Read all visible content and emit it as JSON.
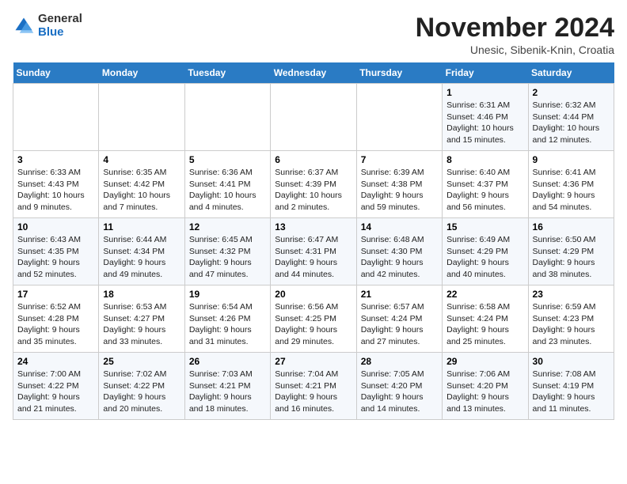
{
  "logo": {
    "general": "General",
    "blue": "Blue"
  },
  "title": "November 2024",
  "subtitle": "Unesic, Sibenik-Knin, Croatia",
  "days_of_week": [
    "Sunday",
    "Monday",
    "Tuesday",
    "Wednesday",
    "Thursday",
    "Friday",
    "Saturday"
  ],
  "weeks": [
    [
      {
        "day": "",
        "info": ""
      },
      {
        "day": "",
        "info": ""
      },
      {
        "day": "",
        "info": ""
      },
      {
        "day": "",
        "info": ""
      },
      {
        "day": "",
        "info": ""
      },
      {
        "day": "1",
        "info": "Sunrise: 6:31 AM\nSunset: 4:46 PM\nDaylight: 10 hours and 15 minutes."
      },
      {
        "day": "2",
        "info": "Sunrise: 6:32 AM\nSunset: 4:44 PM\nDaylight: 10 hours and 12 minutes."
      }
    ],
    [
      {
        "day": "3",
        "info": "Sunrise: 6:33 AM\nSunset: 4:43 PM\nDaylight: 10 hours and 9 minutes."
      },
      {
        "day": "4",
        "info": "Sunrise: 6:35 AM\nSunset: 4:42 PM\nDaylight: 10 hours and 7 minutes."
      },
      {
        "day": "5",
        "info": "Sunrise: 6:36 AM\nSunset: 4:41 PM\nDaylight: 10 hours and 4 minutes."
      },
      {
        "day": "6",
        "info": "Sunrise: 6:37 AM\nSunset: 4:39 PM\nDaylight: 10 hours and 2 minutes."
      },
      {
        "day": "7",
        "info": "Sunrise: 6:39 AM\nSunset: 4:38 PM\nDaylight: 9 hours and 59 minutes."
      },
      {
        "day": "8",
        "info": "Sunrise: 6:40 AM\nSunset: 4:37 PM\nDaylight: 9 hours and 56 minutes."
      },
      {
        "day": "9",
        "info": "Sunrise: 6:41 AM\nSunset: 4:36 PM\nDaylight: 9 hours and 54 minutes."
      }
    ],
    [
      {
        "day": "10",
        "info": "Sunrise: 6:43 AM\nSunset: 4:35 PM\nDaylight: 9 hours and 52 minutes."
      },
      {
        "day": "11",
        "info": "Sunrise: 6:44 AM\nSunset: 4:34 PM\nDaylight: 9 hours and 49 minutes."
      },
      {
        "day": "12",
        "info": "Sunrise: 6:45 AM\nSunset: 4:32 PM\nDaylight: 9 hours and 47 minutes."
      },
      {
        "day": "13",
        "info": "Sunrise: 6:47 AM\nSunset: 4:31 PM\nDaylight: 9 hours and 44 minutes."
      },
      {
        "day": "14",
        "info": "Sunrise: 6:48 AM\nSunset: 4:30 PM\nDaylight: 9 hours and 42 minutes."
      },
      {
        "day": "15",
        "info": "Sunrise: 6:49 AM\nSunset: 4:29 PM\nDaylight: 9 hours and 40 minutes."
      },
      {
        "day": "16",
        "info": "Sunrise: 6:50 AM\nSunset: 4:29 PM\nDaylight: 9 hours and 38 minutes."
      }
    ],
    [
      {
        "day": "17",
        "info": "Sunrise: 6:52 AM\nSunset: 4:28 PM\nDaylight: 9 hours and 35 minutes."
      },
      {
        "day": "18",
        "info": "Sunrise: 6:53 AM\nSunset: 4:27 PM\nDaylight: 9 hours and 33 minutes."
      },
      {
        "day": "19",
        "info": "Sunrise: 6:54 AM\nSunset: 4:26 PM\nDaylight: 9 hours and 31 minutes."
      },
      {
        "day": "20",
        "info": "Sunrise: 6:56 AM\nSunset: 4:25 PM\nDaylight: 9 hours and 29 minutes."
      },
      {
        "day": "21",
        "info": "Sunrise: 6:57 AM\nSunset: 4:24 PM\nDaylight: 9 hours and 27 minutes."
      },
      {
        "day": "22",
        "info": "Sunrise: 6:58 AM\nSunset: 4:24 PM\nDaylight: 9 hours and 25 minutes."
      },
      {
        "day": "23",
        "info": "Sunrise: 6:59 AM\nSunset: 4:23 PM\nDaylight: 9 hours and 23 minutes."
      }
    ],
    [
      {
        "day": "24",
        "info": "Sunrise: 7:00 AM\nSunset: 4:22 PM\nDaylight: 9 hours and 21 minutes."
      },
      {
        "day": "25",
        "info": "Sunrise: 7:02 AM\nSunset: 4:22 PM\nDaylight: 9 hours and 20 minutes."
      },
      {
        "day": "26",
        "info": "Sunrise: 7:03 AM\nSunset: 4:21 PM\nDaylight: 9 hours and 18 minutes."
      },
      {
        "day": "27",
        "info": "Sunrise: 7:04 AM\nSunset: 4:21 PM\nDaylight: 9 hours and 16 minutes."
      },
      {
        "day": "28",
        "info": "Sunrise: 7:05 AM\nSunset: 4:20 PM\nDaylight: 9 hours and 14 minutes."
      },
      {
        "day": "29",
        "info": "Sunrise: 7:06 AM\nSunset: 4:20 PM\nDaylight: 9 hours and 13 minutes."
      },
      {
        "day": "30",
        "info": "Sunrise: 7:08 AM\nSunset: 4:19 PM\nDaylight: 9 hours and 11 minutes."
      }
    ]
  ]
}
